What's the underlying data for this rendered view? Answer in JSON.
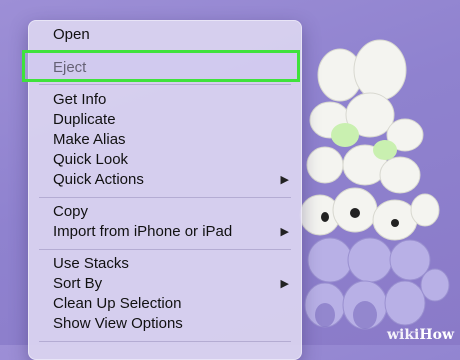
{
  "menu": {
    "items": [
      {
        "label": "Open",
        "submenu": false
      },
      {
        "label": "Eject",
        "submenu": false
      },
      {
        "label": "Get Info",
        "submenu": false
      },
      {
        "label": "Duplicate",
        "submenu": false
      },
      {
        "label": "Make Alias",
        "submenu": false
      },
      {
        "label": "Quick Look",
        "submenu": false
      },
      {
        "label": "Quick Actions",
        "submenu": true
      },
      {
        "label": "Copy",
        "submenu": false
      },
      {
        "label": "Import from iPhone or iPad",
        "submenu": true
      },
      {
        "label": "Use Stacks",
        "submenu": false
      },
      {
        "label": "Sort By",
        "submenu": true
      },
      {
        "label": "Clean Up Selection",
        "submenu": false
      },
      {
        "label": "Show View Options",
        "submenu": false
      }
    ],
    "submenu_arrow": "▶",
    "highlighted_item": "Eject"
  },
  "watermark": {
    "part1": "wiki",
    "part2": "How"
  },
  "colors": {
    "highlight_border": "#3fe23c",
    "menu_bg": "#dad4f0",
    "wallpaper": "#9a8cd4"
  }
}
